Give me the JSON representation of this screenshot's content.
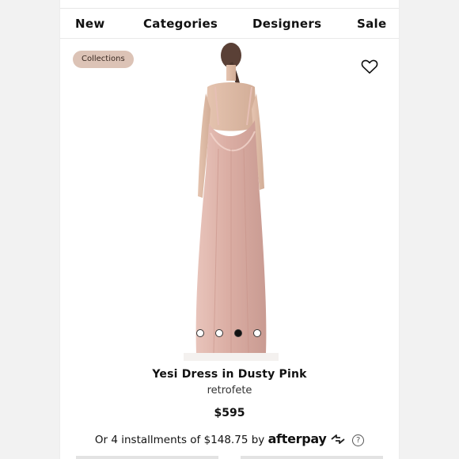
{
  "nav": {
    "items": [
      {
        "label": "New"
      },
      {
        "label": "Categories"
      },
      {
        "label": "Designers"
      },
      {
        "label": "Sale"
      }
    ]
  },
  "badge": {
    "label": "Collections"
  },
  "icons": {
    "favorite": "heart-icon",
    "help": "question-circle-icon",
    "afterpay": "afterpay-arrows-icon"
  },
  "carousel": {
    "count": 4,
    "active_index": 2
  },
  "product": {
    "title": "Yesi Dress in Dusty Pink",
    "designer": "retrofete",
    "price": "$595"
  },
  "installments": {
    "text": "Or 4 installments of $148.75 by",
    "provider": "afterpay",
    "help": "?"
  },
  "colors": {
    "badge_bg": "#dcc3b6",
    "dress": "#e3b8ae",
    "background": "#f2f2f2"
  }
}
